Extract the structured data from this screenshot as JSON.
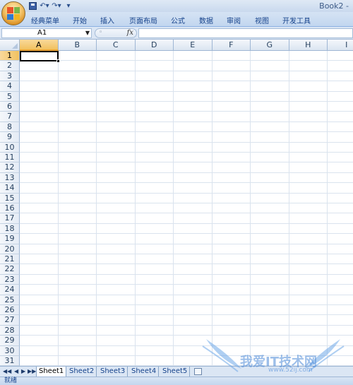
{
  "window": {
    "doc_title": "Book2 -"
  },
  "quick_access": {
    "items": [
      "save-icon",
      "undo-icon",
      "redo-icon",
      "customize-icon"
    ]
  },
  "ribbon": {
    "tabs": [
      "经典菜单",
      "开始",
      "插入",
      "页面布局",
      "公式",
      "数据",
      "审阅",
      "视图",
      "开发工具"
    ]
  },
  "formula_bar": {
    "name_box": "A1",
    "fx_label": "fx",
    "formula": ""
  },
  "grid": {
    "columns": [
      "A",
      "B",
      "C",
      "D",
      "E",
      "F",
      "G",
      "H",
      "I"
    ],
    "rows": [
      "1",
      "2",
      "3",
      "4",
      "5",
      "6",
      "7",
      "8",
      "9",
      "10",
      "11",
      "12",
      "13",
      "14",
      "15",
      "16",
      "17",
      "18",
      "19",
      "20",
      "21",
      "22",
      "23",
      "24",
      "25",
      "26",
      "27",
      "28",
      "29",
      "30",
      "31"
    ],
    "active_cell": "A1"
  },
  "sheets": {
    "tabs": [
      "Sheet1",
      "Sheet2",
      "Sheet3",
      "Sheet4",
      "Sheet5"
    ],
    "active": "Sheet1"
  },
  "status": {
    "text": "就绪"
  },
  "watermark": {
    "text": "我爱IT技术网",
    "url": "www.52ij.com"
  }
}
